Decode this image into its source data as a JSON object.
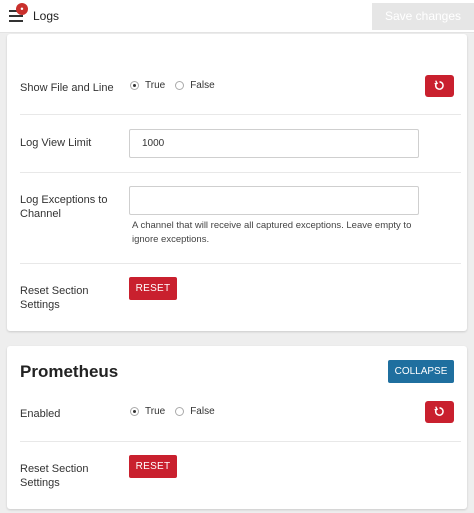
{
  "header": {
    "badge": "•",
    "title": "Logs",
    "save_label": "Save changes"
  },
  "section1": {
    "show_file_line": {
      "label": "Show File and Line",
      "options": [
        "True",
        "False"
      ],
      "selected": "True"
    },
    "log_view_limit": {
      "label": "Log View Limit",
      "value": "1000"
    },
    "log_exceptions": {
      "label": "Log Exceptions to Channel",
      "value": "",
      "help": "A channel that will receive all captured exceptions. Leave empty to ignore exceptions."
    },
    "reset": {
      "label": "Reset Section Settings",
      "button": "RESET"
    }
  },
  "section2": {
    "title": "Prometheus",
    "collapse_label": "COLLAPSE",
    "enabled": {
      "label": "Enabled",
      "options": [
        "True",
        "False"
      ],
      "selected": "True"
    },
    "reset": {
      "label": "Reset Section Settings",
      "button": "RESET"
    }
  },
  "colors": {
    "danger": "#c9202e",
    "primary": "#1f6f9f",
    "background": "#eeeeee"
  }
}
